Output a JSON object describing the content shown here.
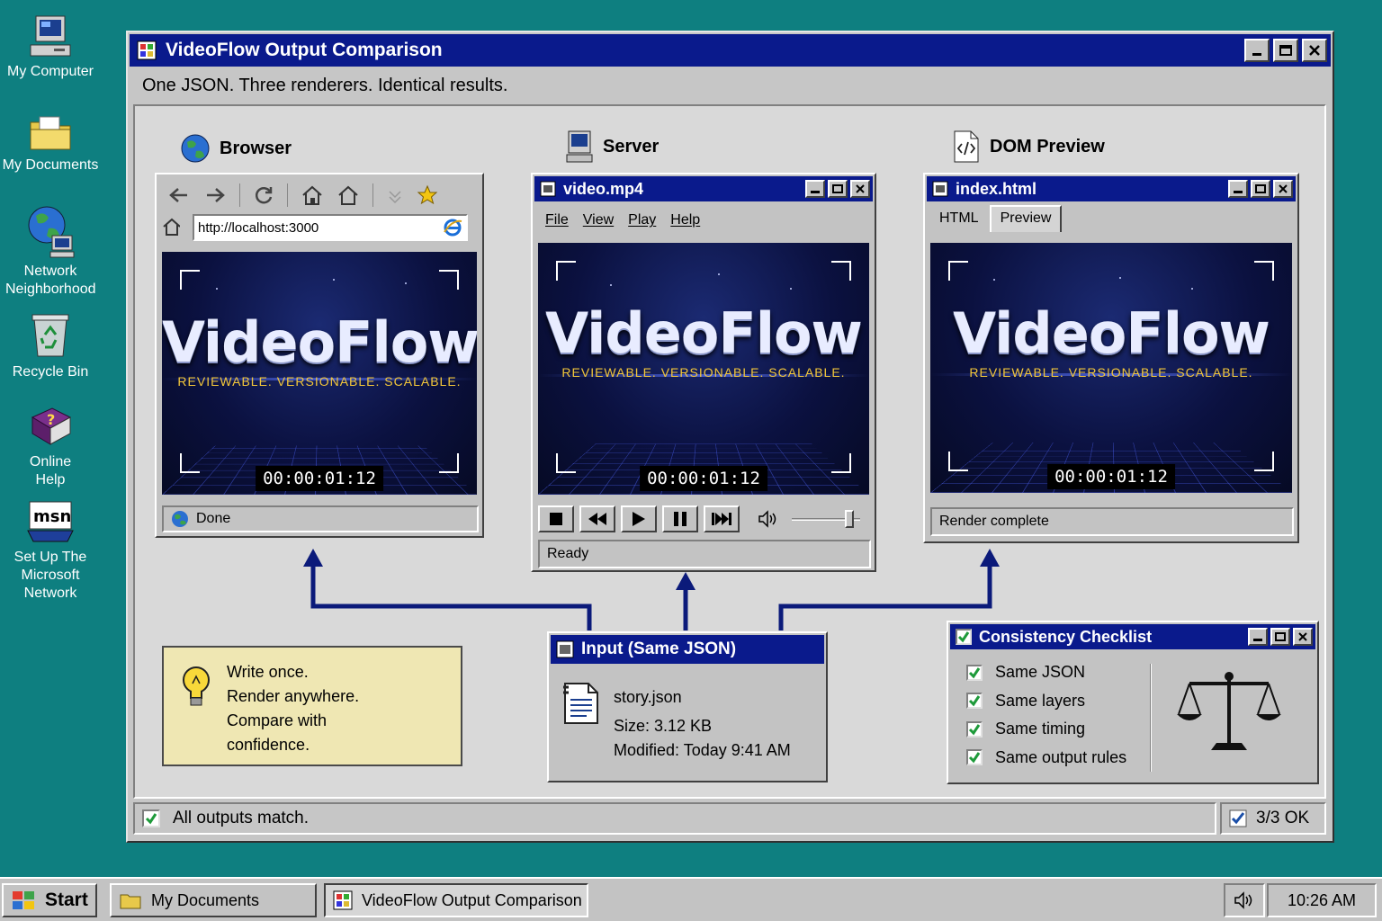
{
  "desktop": {
    "icons": [
      {
        "label": "My Computer"
      },
      {
        "label": "My Documents"
      },
      {
        "label": "Network Neighborhood"
      },
      {
        "label": "Recycle Bin"
      },
      {
        "label": "Online Help"
      },
      {
        "label": "Set Up The Microsoft Network"
      }
    ]
  },
  "window": {
    "title": "VideoFlow Output Comparison",
    "subtitle": "One JSON. Three renderers. Identical results.",
    "status_text": "All outputs match.",
    "status_count": "3/3 OK"
  },
  "frame": {
    "logo": "VideoFlow",
    "tagline": "REVIEWABLE. VERSIONABLE. SCALABLE.",
    "timecode": "00:00:01:12"
  },
  "browser": {
    "heading": "Browser",
    "url": "http://localhost:3000",
    "status": "Done"
  },
  "server": {
    "heading": "Server",
    "window_title": "video.mp4",
    "menu": [
      "File",
      "View",
      "Play",
      "Help"
    ],
    "status": "Ready",
    "volume": 0.9
  },
  "dom": {
    "heading": "DOM Preview",
    "window_title": "index.html",
    "tabs": [
      "HTML",
      "Preview"
    ],
    "active_tab": "Preview",
    "status": "Render complete"
  },
  "input": {
    "title": "Input (Same JSON)",
    "filename": "story.json",
    "size": "Size: 3.12 KB",
    "modified": "Modified: Today 9:41 AM"
  },
  "note": {
    "lines": [
      "Write once.",
      "Render anywhere.",
      "Compare with",
      "confidence."
    ]
  },
  "checklist": {
    "title": "Consistency Checklist",
    "items": [
      "Same JSON",
      "Same layers",
      "Same timing",
      "Same output rules"
    ]
  },
  "taskbar": {
    "start": "Start",
    "tasks": [
      "My Documents",
      "VideoFlow Output Comparison"
    ],
    "clock": "10:26 AM"
  },
  "colors": {
    "desktop": "#0e7f80",
    "titlebar": "#0a1a8c",
    "arrow": "#0b1a7a",
    "note": "#efe7b3",
    "tagline": "#f3c73a"
  }
}
